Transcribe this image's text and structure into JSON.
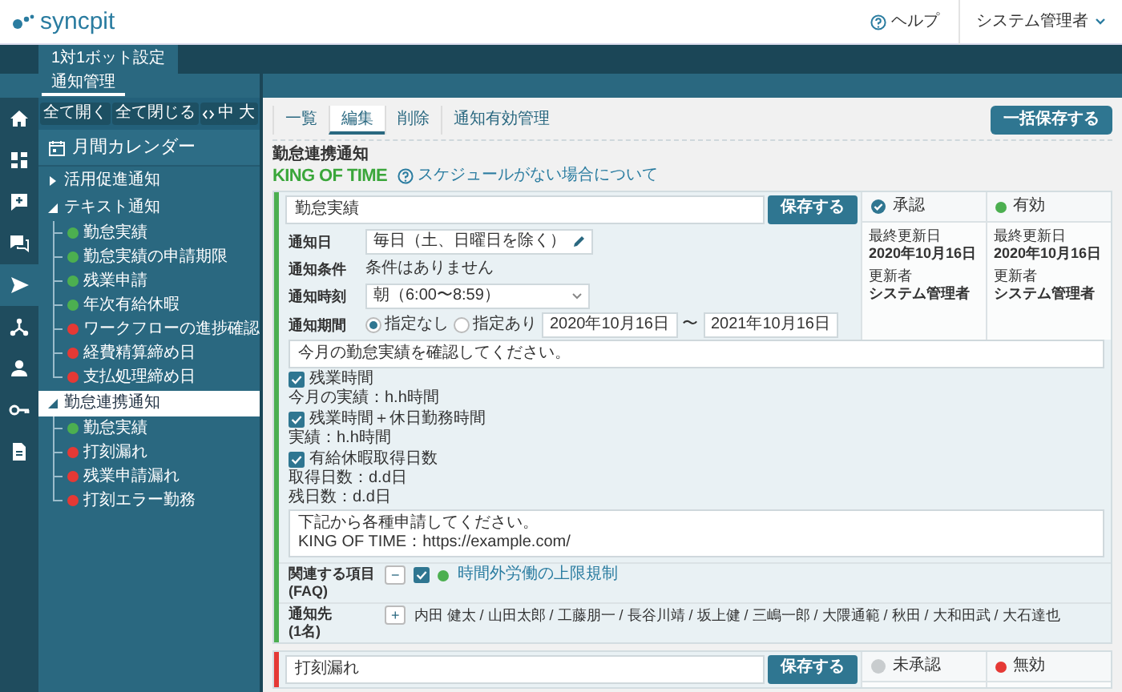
{
  "header": {
    "logo": "syncpit",
    "help": "ヘルプ",
    "user": "システム管理者"
  },
  "sidebar": {
    "tab": "1対1ボット設定",
    "subtab": "通知管理",
    "nav_icons": [
      {
        "kind": "home",
        "selected": false
      },
      {
        "kind": "grid",
        "selected": false
      },
      {
        "kind": "chat-plus",
        "selected": false
      },
      {
        "kind": "chat",
        "selected": false
      },
      {
        "kind": "send",
        "selected": true
      },
      {
        "kind": "network",
        "selected": false
      },
      {
        "kind": "user",
        "selected": false
      },
      {
        "kind": "key",
        "selected": false
      },
      {
        "kind": "document",
        "selected": false
      }
    ],
    "toolbar": [
      "全て開く",
      "全て閉じる"
    ],
    "font_sizes": [
      "中",
      "大"
    ],
    "calendar": "月間カレンダー",
    "tree": [
      {
        "label": "活用促進通知",
        "expanded": false,
        "selected": false
      },
      {
        "label": "テキスト通知",
        "expanded": true,
        "selected": false,
        "children": [
          {
            "label": "勤怠実績",
            "color": "#4caf50"
          },
          {
            "label": "勤怠実績の申請期限",
            "color": "#4caf50"
          },
          {
            "label": "残業申請",
            "color": "#4caf50"
          },
          {
            "label": "年次有給休暇",
            "color": "#4caf50"
          },
          {
            "label": "ワークフローの進捗確認",
            "color": "#e53935"
          },
          {
            "label": "経費精算締め日",
            "color": "#e53935"
          },
          {
            "label": "支払処理締め日",
            "color": "#e53935"
          }
        ]
      },
      {
        "label": "勤怠連携通知",
        "expanded": true,
        "selected": true,
        "children": [
          {
            "label": "勤怠実績",
            "color": "#4caf50"
          },
          {
            "label": "打刻漏れ",
            "color": "#e53935"
          },
          {
            "label": "残業申請漏れ",
            "color": "#e53935"
          },
          {
            "label": "打刻エラー勤務",
            "color": "#e53935"
          }
        ]
      }
    ]
  },
  "main": {
    "tabs": [
      {
        "label": "一覧",
        "selected": false
      },
      {
        "label": "編集",
        "selected": true
      },
      {
        "label": "削除",
        "selected": false
      },
      {
        "label": "通知有効管理",
        "selected": false
      }
    ],
    "bulk_save": "一括保存する",
    "title": "勤怠連携通知",
    "brand": "KING OF TIME",
    "help_link": "スケジュールがない場合について",
    "cards": [
      {
        "name": "勤怠実績",
        "save": "保存する",
        "color": "#4caf50",
        "approval": {
          "label": "承認",
          "approved": true,
          "meta": [
            {
              "label": "最終更新日",
              "value": "2020年10月16日"
            },
            {
              "label": "更新者",
              "value": "システム管理者"
            }
          ]
        },
        "status": {
          "label": "有効",
          "color": "#4caf50",
          "meta": [
            {
              "label": "最終更新日",
              "value": "2020年10月16日"
            },
            {
              "label": "更新者",
              "value": "システム管理者"
            }
          ]
        },
        "form": [
          {
            "kind": "field",
            "label": "通知日",
            "value": "毎日（土、日曜日を除く）"
          },
          {
            "kind": "text",
            "label": "通知条件",
            "value": "条件はありません"
          },
          {
            "kind": "select",
            "label": "通知時刻",
            "value": "朝（6:00〜8:59）"
          },
          {
            "kind": "period",
            "label": "通知期間",
            "options": [
              {
                "label": "指定なし",
                "selected": true
              },
              {
                "label": "指定あり",
                "selected": false
              }
            ],
            "from": "2020年10月16日",
            "separator": "〜",
            "to": "2021年10月16日"
          }
        ],
        "message": "今月の勤怠実績を確認してください。",
        "metrics": [
          {
            "label": "残業時間",
            "checked": true,
            "lines": [
              "今月の実績：h.h時間"
            ]
          },
          {
            "label": "残業時間＋休日勤務時間",
            "checked": true,
            "lines": [
              "実績：h.h時間"
            ]
          },
          {
            "label": "有給休暇取得日数",
            "checked": true,
            "lines": [
              "取得日数：d.d日",
              "残日数：d.d日"
            ]
          }
        ],
        "note": "下記から各種申請してください。\nKING OF TIME：https://example.com/",
        "related": {
          "label": "関連する項目",
          "sublabel": "(FAQ)",
          "toggle": "−",
          "items": [
            {
              "label": "時間外労働の上限規制",
              "checked": true,
              "color": "#4caf50"
            }
          ]
        },
        "recipients": {
          "label": "通知先",
          "count": "(1名)",
          "toggle": "+",
          "names": "内田 健太 / 山田太郎 / 工藤朋一 / 長谷川靖 / 坂上健 / 三嶋一郎 / 大隈通範 / 秋田 / 大和田武 / 大石達也"
        }
      },
      {
        "name": "打刻漏れ",
        "save": "保存する",
        "color": "#e53935",
        "approval": {
          "label": "未承認",
          "approved": false
        },
        "status": {
          "label": "無効",
          "color": "#e53935"
        }
      }
    ]
  }
}
